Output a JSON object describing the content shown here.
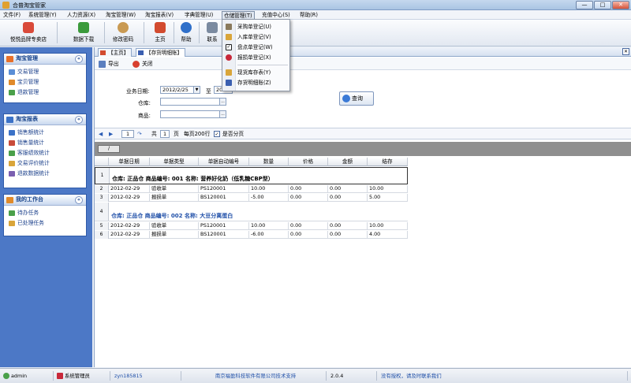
{
  "window": {
    "title": "合普淘宝管家",
    "min": "—",
    "max": "□",
    "close": "✕"
  },
  "menu": {
    "items": [
      "文件(F)",
      "系统管理(Y)",
      "人力资源(X)",
      "淘宝管理(W)",
      "淘宝报表(V)",
      "字典管理(U)",
      "仓储管理(T)",
      "充值中心(S)",
      "帮助(R)"
    ],
    "active_index": 6
  },
  "toolbar": {
    "buttons": [
      {
        "label": "悦悦品牌专卖店",
        "icon": "shop-icon",
        "color": "#d94a3a"
      },
      {
        "label": "数据下载",
        "icon": "download-icon",
        "color": "#3b9a3b"
      },
      {
        "label": "修改密码",
        "icon": "user-icon",
        "color": "#c99a53"
      },
      {
        "label": "主页",
        "icon": "home-icon",
        "color": "#d24b2f"
      },
      {
        "label": "帮助",
        "icon": "help-icon",
        "color": "#2f6fc9"
      },
      {
        "label": "联系",
        "icon": "contact-icon",
        "color": "#7a8aa0"
      }
    ]
  },
  "dropdown": {
    "items": [
      {
        "label": "采购单登记(U)",
        "icon": "purchase-icon",
        "color": "#8a7a5c"
      },
      {
        "label": "入库单登记(V)",
        "icon": "stock-in-icon",
        "color": "#d9a53a"
      },
      {
        "label": "盘点单登记(W)",
        "icon": "check-icon",
        "color": "#222222"
      },
      {
        "label": "报损单登记(X)",
        "icon": "loss-icon",
        "color": "#c8283a"
      },
      {
        "label": "现货库存表(Y)",
        "icon": "inventory-icon",
        "color": "#d9a53a"
      },
      {
        "label": "存货明细账(Z)",
        "icon": "ledger-icon",
        "color": "#3a5fb0"
      }
    ]
  },
  "sidebar": {
    "panels": [
      {
        "title": "淘宝管理",
        "items": [
          "交易管理",
          "宝贝管理",
          "退款管理"
        ]
      },
      {
        "title": "淘宝报表",
        "items": [
          "销售额统计",
          "销售量统计",
          "客服绩效统计",
          "交易评价统计",
          "退款数据统计"
        ]
      },
      {
        "title": "我的工作台",
        "items": [
          "待办任务",
          "已处理任务"
        ]
      }
    ],
    "collapse_glyph": "«"
  },
  "tabs": [
    {
      "label": "【主页】"
    },
    {
      "label": "【存货明细账】"
    }
  ],
  "subbar": {
    "export": "导出",
    "close": "关闭"
  },
  "form": {
    "date_label": "业务日期:",
    "date_from": "2012/2/25",
    "to_label": "至",
    "date_to": "20",
    "warehouse_label": "仓库:",
    "warehouse_value": "",
    "product_label": "商品:",
    "product_value": "",
    "query": "查询",
    "ellipsis": "..."
  },
  "pager": {
    "page": "1",
    "total_label": "共",
    "total_pages": "1",
    "page_unit": "页",
    "per_page": "每页200行",
    "paginate_label": "是否分页",
    "paginate_checked": true
  },
  "groupbar": {
    "label": "/"
  },
  "grid": {
    "columns": [
      "单据日期",
      "单据类型",
      "单据自动编号",
      "数量",
      "价格",
      "金额",
      "结存"
    ],
    "groups": [
      {
        "rownum": "1",
        "header": "仓库: 正品仓 商品编号: 001 名称: 营养好化奶（低乳糖CBP型）",
        "rows": [
          {
            "rn": "2",
            "cells": [
              "2012-02-29",
              "验收单",
              "PS120001",
              "10.00",
              "0.00",
              "0.00",
              "10.00"
            ]
          },
          {
            "rn": "3",
            "cells": [
              "2012-02-29",
              "报损单",
              "BS120001",
              "-5.00",
              "0.00",
              "0.00",
              "5.00"
            ]
          }
        ]
      },
      {
        "rownum": "4",
        "header": "仓库: 正品仓 商品编号: 002 名称: 大豆分离蛋白",
        "rows": [
          {
            "rn": "5",
            "cells": [
              "2012-02-29",
              "验收单",
              "PS120001",
              "10.00",
              "0.00",
              "0.00",
              "10.00"
            ]
          },
          {
            "rn": "6",
            "cells": [
              "2012-02-29",
              "报损单",
              "BS120001",
              "-6.00",
              "0.00",
              "0.00",
              "4.00"
            ]
          }
        ]
      }
    ]
  },
  "statusbar": {
    "user": "admin",
    "role": "系统管理员",
    "account": "zyn185815",
    "company": "南京福盈科技软件有限公司技术支持",
    "version": "2.0.4",
    "license": "没有授权，请及时联系我们"
  }
}
